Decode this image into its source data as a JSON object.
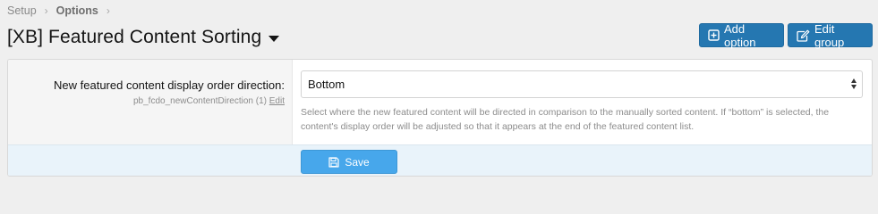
{
  "breadcrumb": {
    "items": [
      "Setup",
      "Options"
    ],
    "separator": "›"
  },
  "header": {
    "title": "[XB] Featured Content Sorting",
    "add_option_label": "Add option",
    "edit_group_label": "Edit group"
  },
  "option": {
    "label": "New featured content display order direction:",
    "hint_id": "pb_fcdo_newContentDirection (1)",
    "edit_label": "Edit",
    "selected_value": "Bottom",
    "explain": "Select where the new featured content will be directed in comparison to the manually sorted content. If “bottom” is selected, the content's display order will be adjusted so that it appears at the end of the featured content list."
  },
  "footer": {
    "save_label": "Save"
  },
  "colors": {
    "primary_button": "#2577b1",
    "save_button": "#47a7eb",
    "footer_bg": "#e9f3fa"
  },
  "icons": {
    "add_option": "plus-square-icon",
    "edit_group": "edit-icon",
    "save": "save-icon"
  }
}
